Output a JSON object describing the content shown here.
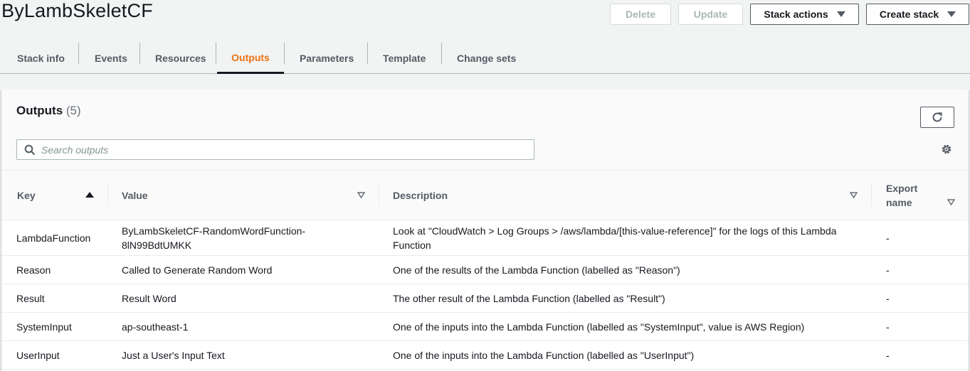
{
  "page": {
    "title": "ByLambSkeletCF"
  },
  "actions": {
    "delete": "Delete",
    "update": "Update",
    "stack_actions": "Stack actions",
    "create_stack": "Create stack"
  },
  "tabs": [
    {
      "label": "Stack info"
    },
    {
      "label": "Events"
    },
    {
      "label": "Resources"
    },
    {
      "label": "Outputs",
      "active": true
    },
    {
      "label": "Parameters"
    },
    {
      "label": "Template"
    },
    {
      "label": "Change sets"
    }
  ],
  "outputs": {
    "title": "Outputs",
    "count": "(5)",
    "search_placeholder": "Search outputs",
    "columns": {
      "key": "Key",
      "value": "Value",
      "description": "Description",
      "export_line1": "Export",
      "export_line2": "name"
    },
    "rows": [
      {
        "key": "LambdaFunction",
        "value_line1": "ByLambSkeletCF-RandomWordFunction-",
        "value_line2": "8lN99BdtUMKK",
        "description_line1": "Look at \"CloudWatch > Log Groups > /aws/lambda/[this-value-reference]\" for the logs of this Lambda",
        "description_line2": "Function",
        "export": "-"
      },
      {
        "key": "Reason",
        "value": "Called to Generate Random Word",
        "description": "One of the results of the Lambda Function (labelled as \"Reason\")",
        "export": "-"
      },
      {
        "key": "Result",
        "value": "Result Word",
        "description": "The other result of the Lambda Function (labelled as \"Result\")",
        "export": "-"
      },
      {
        "key": "SystemInput",
        "value": "ap-southeast-1",
        "description": "One of the inputs into the Lambda Function (labelled as \"SystemInput\", value is AWS Region)",
        "export": "-"
      },
      {
        "key": "UserInput",
        "value": "Just a User's Input Text",
        "description": "One of the inputs into the Lambda Function (labelled as \"UserInput\")",
        "export": "-"
      }
    ]
  },
  "colors": {
    "active_tab": "#ec7211",
    "text": "#16191f",
    "muted": "#545b64"
  },
  "icons": {
    "refresh": "refresh-icon",
    "search": "search-icon",
    "settings": "gear-icon"
  }
}
